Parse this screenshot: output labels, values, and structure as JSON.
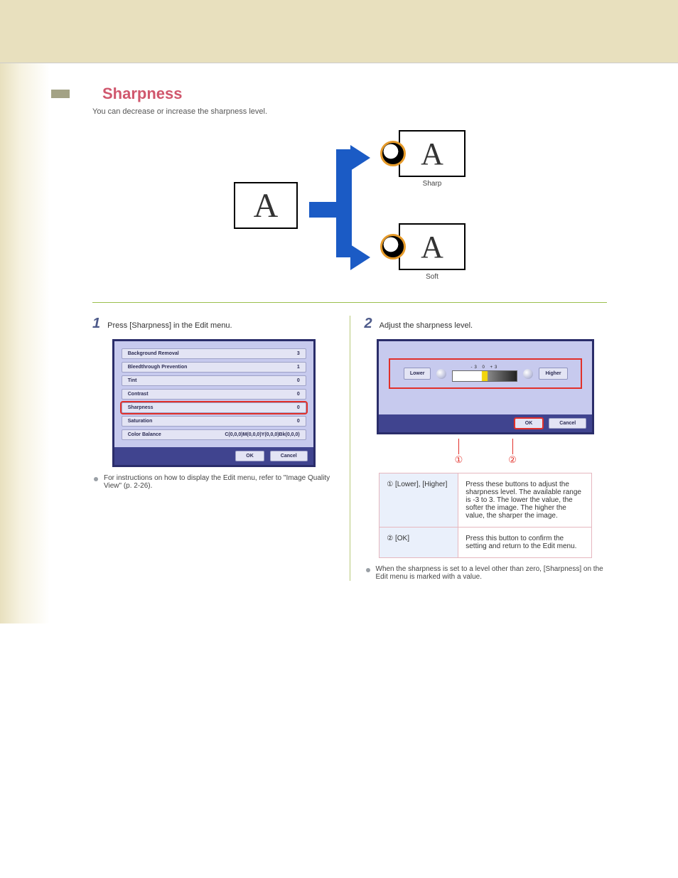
{
  "header": {
    "title": "Sharpness",
    "subtitle": "You can decrease or increase the sharpness level."
  },
  "illustration": {
    "variants": [
      "Sharp",
      "Soft"
    ]
  },
  "step1": {
    "num": "1",
    "text": "Press [Sharpness] in the Edit menu.",
    "rows": [
      {
        "label": "Background Removal",
        "val": "3"
      },
      {
        "label": "Bleedthrough Prevention",
        "val": "1"
      },
      {
        "label": "Tint",
        "val": "0"
      },
      {
        "label": "Contrast",
        "val": "0"
      },
      {
        "label": "Sharpness",
        "val": "0"
      },
      {
        "label": "Saturation",
        "val": "0"
      },
      {
        "label": "Color Balance",
        "val": "C(0,0,0)M(0,0,0)Y(0,0,0)Bk(0,0,0)"
      }
    ],
    "ok": "OK",
    "cancel": "Cancel",
    "bullet": "For instructions on how to display the Edit menu, refer to \"Image Quality View\" (p. 2-26)."
  },
  "step2": {
    "num": "2",
    "text": "Adjust the sharpness level.",
    "lower": "Lower",
    "higher": "Higher",
    "ticks": "-3       0      +3",
    "ok": "OK",
    "cancel": "Cancel",
    "callouts": [
      "①",
      "②"
    ],
    "table": [
      {
        "h": "① [Lower], [Higher]",
        "d": "Press these buttons to adjust the sharpness level. The available range is -3 to 3. The lower the value, the softer the image. The higher the value, the sharper the image."
      },
      {
        "h": "② [OK]",
        "d": "Press this button to confirm the setting and return to the Edit menu."
      }
    ],
    "bullet": "When the sharpness is set to a level other than zero, [Sharpness] on the Edit menu is marked with a value."
  }
}
